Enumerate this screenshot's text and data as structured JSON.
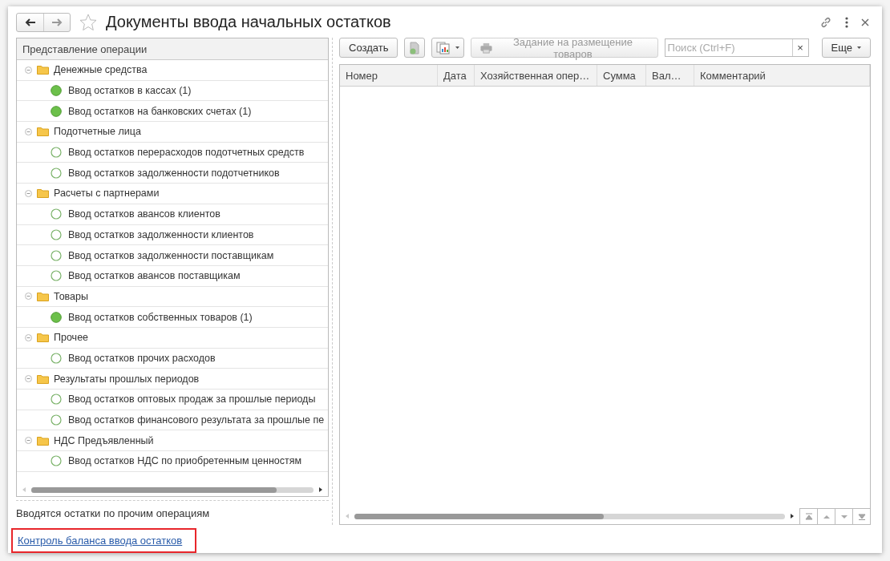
{
  "window": {
    "title": "Документы ввода начальных остатков",
    "favorite": false
  },
  "nav": [
    {
      "kind": "back",
      "disabled": false
    },
    {
      "kind": "forward",
      "disabled": true
    }
  ],
  "tree": {
    "header": "Представление операции",
    "groups": [
      {
        "label": "Денежные средства",
        "expanded": true,
        "children": [
          {
            "label": "Ввод остатков в кассах (1)",
            "done": true
          },
          {
            "label": "Ввод остатков на банковских счетах (1)",
            "done": true
          }
        ]
      },
      {
        "label": "Подотчетные лица",
        "expanded": true,
        "children": [
          {
            "label": "Ввод остатков перерасходов подотчетных средств",
            "done": false
          },
          {
            "label": "Ввод остатков задолженности подотчетников",
            "done": false
          }
        ]
      },
      {
        "label": "Расчеты с партнерами",
        "expanded": true,
        "children": [
          {
            "label": "Ввод остатков авансов клиентов",
            "done": false
          },
          {
            "label": "Ввод остатков задолженности клиентов",
            "done": false
          },
          {
            "label": "Ввод остатков задолженности поставщикам",
            "done": false
          },
          {
            "label": "Ввод остатков авансов поставщикам",
            "done": false
          }
        ]
      },
      {
        "label": "Товары",
        "expanded": true,
        "children": [
          {
            "label": "Ввод остатков собственных товаров (1)",
            "done": true
          }
        ]
      },
      {
        "label": "Прочее",
        "expanded": true,
        "children": [
          {
            "label": "Ввод остатков прочих расходов",
            "done": false
          }
        ]
      },
      {
        "label": "Результаты прошлых периодов",
        "expanded": true,
        "children": [
          {
            "label": "Ввод остатков оптовых продаж за прошлые периоды",
            "done": false
          },
          {
            "label": "Ввод остатков финансового результата за прошлые пе",
            "done": false
          }
        ]
      },
      {
        "label": "НДС Предъявленный",
        "expanded": true,
        "children": [
          {
            "label": "Ввод остатков НДС по приобретенным ценностям",
            "done": false
          }
        ]
      }
    ]
  },
  "description": "Вводятся остатки по прочим операциям",
  "link": {
    "label": "Контроль баланса ввода остатков",
    "highlighted": true
  },
  "toolbar": {
    "create": "Создать",
    "print_task": {
      "label": "Задание на размещение товаров",
      "disabled": true
    },
    "search": {
      "placeholder": "Поиск (Ctrl+F)",
      "clear": "×"
    },
    "more": "Еще"
  },
  "table": {
    "columns": [
      "Номер",
      "Дата",
      "Хозяйственная опер…",
      "Сумма",
      "Вал…",
      "Комментарий"
    ]
  }
}
